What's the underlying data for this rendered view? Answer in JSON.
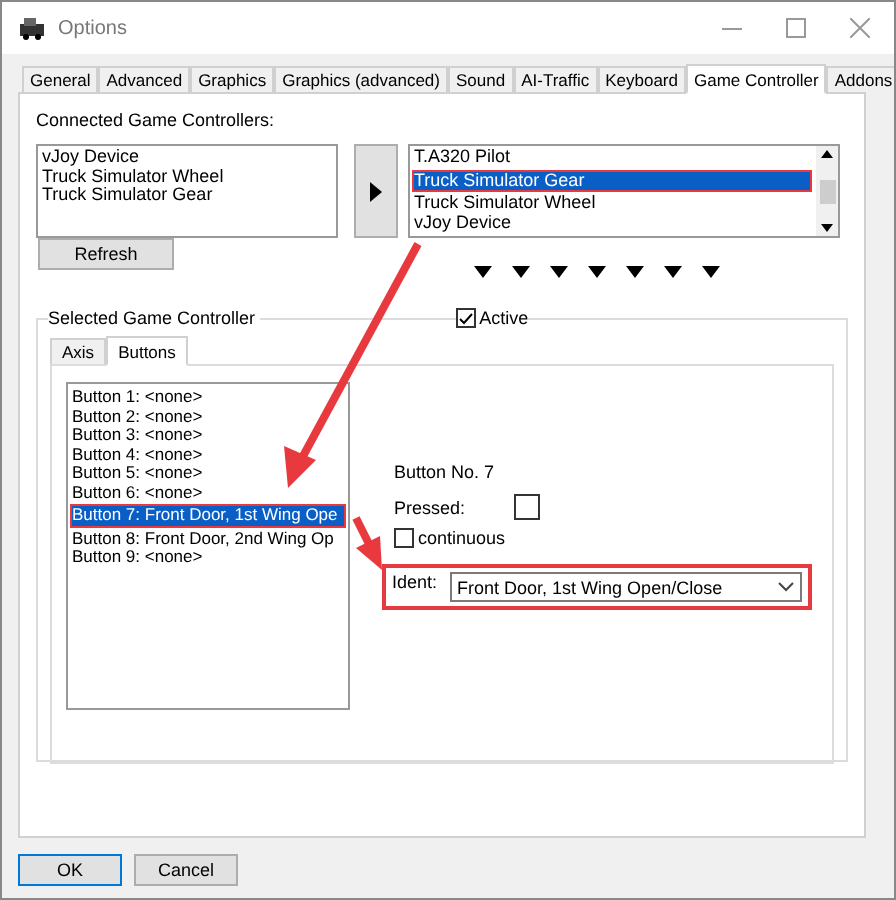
{
  "window": {
    "title": "Options"
  },
  "tabs": [
    {
      "label": "General",
      "selected": false
    },
    {
      "label": "Advanced",
      "selected": false
    },
    {
      "label": "Graphics",
      "selected": false
    },
    {
      "label": "Graphics (advanced)",
      "selected": false
    },
    {
      "label": "Sound",
      "selected": false
    },
    {
      "label": "AI-Traffic",
      "selected": false
    },
    {
      "label": "Keyboard",
      "selected": false
    },
    {
      "label": "Game Controller",
      "selected": true
    },
    {
      "label": "Addons",
      "selected": false
    }
  ],
  "connected_label": "Connected Game Controllers:",
  "connected_devices": [
    "vJoy Device",
    "Truck Simulator Wheel",
    "Truck Simulator Gear"
  ],
  "assigned_devices": [
    {
      "label": "T.A320 Pilot",
      "selected": false,
      "highlighted": false
    },
    {
      "label": "Truck Simulator Gear",
      "selected": true,
      "highlighted": true
    },
    {
      "label": "Truck Simulator Wheel",
      "selected": false,
      "highlighted": false
    },
    {
      "label": "vJoy Device",
      "selected": false,
      "highlighted": false
    }
  ],
  "refresh_button": "Refresh",
  "group_title": "Selected Game Controller",
  "active": {
    "label": "Active",
    "checked": true
  },
  "sub_tabs": [
    {
      "label": "Axis",
      "selected": false
    },
    {
      "label": "Buttons",
      "selected": true
    }
  ],
  "buttons_list": [
    {
      "label": "Button 1: <none>",
      "selected": false,
      "highlighted": false
    },
    {
      "label": "Button 2: <none>",
      "selected": false,
      "highlighted": false
    },
    {
      "label": "Button 3: <none>",
      "selected": false,
      "highlighted": false
    },
    {
      "label": "Button 4: <none>",
      "selected": false,
      "highlighted": false
    },
    {
      "label": "Button 5: <none>",
      "selected": false,
      "highlighted": false
    },
    {
      "label": "Button 6: <none>",
      "selected": false,
      "highlighted": false
    },
    {
      "label": "Button 7: Front Door, 1st Wing Ope",
      "selected": true,
      "highlighted": true
    },
    {
      "label": "Button 8: Front Door, 2nd Wing Op",
      "selected": false,
      "highlighted": false
    },
    {
      "label": "Button 9: <none>",
      "selected": false,
      "highlighted": false
    }
  ],
  "detail": {
    "button_no": "Button No. 7",
    "pressed_label": "Pressed:",
    "pressed": false,
    "continuous": {
      "label": "continuous",
      "checked": false
    },
    "ident_label": "Ident:",
    "ident_value": "Front Door, 1st Wing Open/Close",
    "ident_highlighted": true
  },
  "footer_buttons": [
    {
      "label": "OK",
      "default": true
    },
    {
      "label": "Cancel",
      "default": false
    }
  ]
}
